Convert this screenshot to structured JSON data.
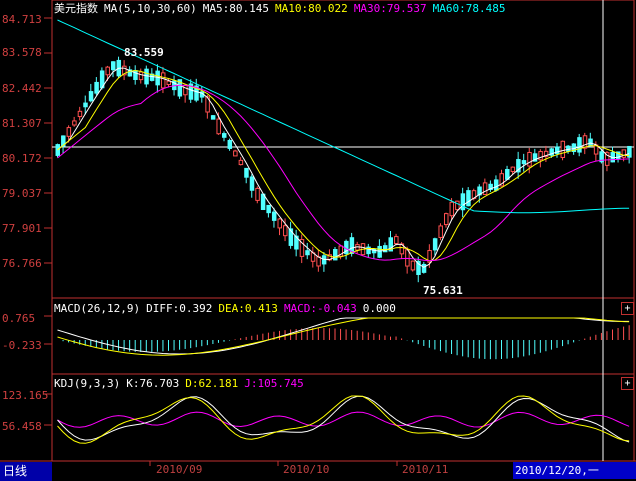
{
  "price_panel": {
    "legend_title": "美元指数",
    "ma_params": "MA(5,10,30,60)",
    "ma5": "MA5:80.145",
    "ma10": "MA10:80.022",
    "ma30": "MA30:79.537",
    "ma60": "MA60:78.485",
    "high_mark": "83.559",
    "low_mark": "75.631",
    "y_labels": [
      "84.713",
      "83.578",
      "82.442",
      "81.307",
      "80.172",
      "79.037",
      "77.901",
      "76.766"
    ]
  },
  "macd_panel": {
    "params": "MACD(26,12,9)",
    "diff": "DIFF:0.392",
    "dea": "DEA:0.413",
    "macd": "MACD:-0.043",
    "zero": "0.000",
    "y_labels": [
      "0.765",
      "-0.233"
    ]
  },
  "kdj_panel": {
    "params": "KDJ(9,3,3)",
    "k": "K:76.703",
    "d": "D:62.181",
    "j": "J:105.745",
    "y_labels": [
      "123.165",
      "56.458"
    ]
  },
  "x_axis": {
    "labels": [
      "2010/09",
      "2010/10",
      "2010/11"
    ]
  },
  "status": {
    "period_tab": "日线",
    "cursor_date": "2010/12/20,一"
  },
  "colors": {
    "up_candle": "#ff5050",
    "down_candle": "#50ffff",
    "ma5": "#ffffff",
    "ma10": "#ffff00",
    "ma30": "#ff00ff",
    "ma60": "#00ffff",
    "frame": "#c03030"
  }
}
